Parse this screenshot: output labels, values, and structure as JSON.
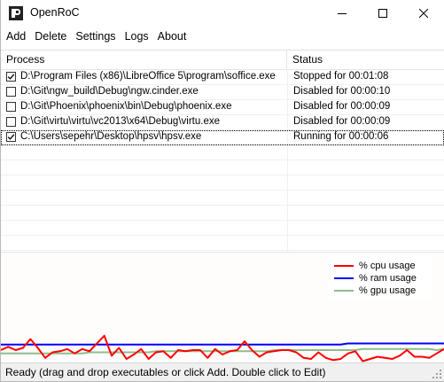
{
  "window": {
    "title": "OpenRoC",
    "icon": "app-icon"
  },
  "menu": {
    "items": [
      "Add",
      "Delete",
      "Settings",
      "Logs",
      "About"
    ]
  },
  "listview": {
    "columns": [
      "Process",
      "Status"
    ],
    "rows": [
      {
        "checked": true,
        "process": "D:\\Program Files (x86)\\LibreOffice 5\\program\\soffice.exe",
        "status": "Stopped for 00:01:08"
      },
      {
        "checked": false,
        "process": "D:\\Git\\ngw_build\\Debug\\ngw.cinder.exe",
        "status": "Disabled for 00:00:10"
      },
      {
        "checked": false,
        "process": "D:\\Git\\Phoenix\\phoenix\\bin\\Debug\\phoenix.exe",
        "status": "Disabled for 00:00:09"
      },
      {
        "checked": false,
        "process": "D:\\Git\\virtu\\virtu\\vc2013\\x64\\Debug\\virtu.exe",
        "status": "Disabled for 00:00:09"
      },
      {
        "checked": true,
        "process": "C:\\Users\\sepehr\\Desktop\\hpsv\\hpsv.exe",
        "status": "Running for 00:00:06",
        "focused": true
      }
    ]
  },
  "chart_data": {
    "type": "line",
    "legend_position": "top-right",
    "grid": false,
    "series": [
      {
        "name": "% cpu usage",
        "color": "#ff0000",
        "values": [
          12,
          15,
          12,
          14,
          22,
          14,
          5,
          10,
          11,
          13,
          9,
          13,
          11,
          18,
          25,
          7,
          14,
          4,
          8,
          13,
          4,
          10,
          11,
          5,
          12,
          11,
          12,
          12,
          5,
          13,
          8,
          11,
          12,
          20,
          12,
          6,
          10,
          11,
          12,
          12,
          10,
          5,
          4,
          10,
          5,
          3,
          4,
          9,
          11,
          2,
          4,
          6,
          5,
          4,
          7,
          12,
          6,
          6,
          5,
          9,
          13
        ]
      },
      {
        "name": "% ram usage",
        "color": "#0000ff",
        "values": [
          17,
          17,
          17,
          17,
          17,
          17,
          17,
          17,
          17,
          17,
          17,
          17,
          17,
          17,
          17,
          17,
          17,
          17,
          17,
          17,
          17,
          17,
          17,
          17,
          17,
          17,
          17,
          17,
          17,
          17,
          17,
          17,
          17,
          17,
          17,
          17,
          17,
          17,
          17,
          17,
          17,
          17,
          17,
          17,
          17,
          17,
          17,
          18,
          18,
          18,
          18,
          18,
          18,
          18,
          18,
          18,
          18,
          18,
          18,
          18,
          18
        ]
      },
      {
        "name": "% gpu usage",
        "color": "#8fbc8f",
        "values": [
          9,
          9,
          9,
          9,
          9,
          9,
          9,
          9,
          9,
          9,
          9,
          9,
          10,
          10,
          10,
          10,
          10,
          10,
          10,
          10,
          10,
          11,
          11,
          11,
          11,
          11,
          11,
          11,
          11,
          11,
          11,
          11,
          11,
          11,
          11,
          11,
          11,
          12,
          12,
          12,
          12,
          12,
          12,
          12,
          12,
          12,
          12,
          12,
          12,
          13,
          13,
          13,
          13,
          13,
          13,
          13,
          13,
          13,
          13,
          12,
          13
        ]
      }
    ],
    "ylim": [
      0,
      100
    ]
  },
  "statusbar": {
    "text": "Ready (drag and drop executables or click Add. Double click to Edit)"
  }
}
